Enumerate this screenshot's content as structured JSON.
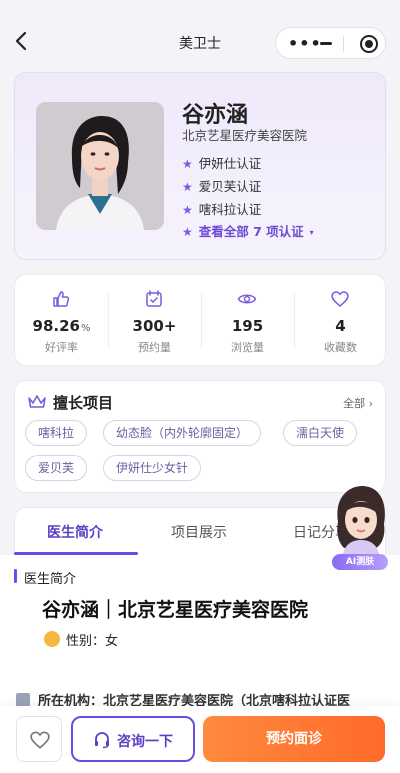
{
  "nav": {
    "title": "美卫士",
    "back_icon": "chevron-left-icon",
    "more_icon": "more-dots-icon",
    "minimize_icon": "minus-icon",
    "close_icon": "target-icon"
  },
  "doctor": {
    "name": "谷亦涵",
    "hospital": "北京艺星医疗美容医院",
    "certifications": [
      "伊妍仕认证",
      "爱贝芙认证",
      "嗐科拉认证"
    ],
    "view_all": "查看全部 7 项认证"
  },
  "stats": [
    {
      "value": "98.26",
      "unit": "%",
      "label": "好评率",
      "icon": "thumbs-up-icon"
    },
    {
      "value": "300+",
      "unit": "",
      "label": "预约量",
      "icon": "calendar-icon"
    },
    {
      "value": "195",
      "unit": "",
      "label": "浏览量",
      "icon": "eye-icon"
    },
    {
      "value": "4",
      "unit": "",
      "label": "收藏数",
      "icon": "heart-icon"
    }
  ],
  "specialties": {
    "title": "擅长项目",
    "all_label": "全部 ›",
    "tags": [
      "嗐科拉",
      "幼态脸（内外轮廓固定）",
      "濡白天使",
      "爱贝芙",
      "伊妍仕少女针"
    ]
  },
  "tabs": [
    {
      "label": "医生简介",
      "active": true
    },
    {
      "label": "项目展示",
      "active": false
    },
    {
      "label": "日记分享",
      "active": false
    }
  ],
  "profile": {
    "section_title": "医生简介",
    "headline": "谷亦涵｜北京艺星医疗美容医院",
    "gender": "性别：女",
    "institution": "所在机构：北京艺星医疗美容医院（北京嗐科拉认证医"
  },
  "ai": {
    "label": "AI测肤"
  },
  "actions": {
    "favorite_icon": "heart-outline-icon",
    "consult_label": "咨询一下",
    "book_label": "预约面诊"
  },
  "colors": {
    "accent": "#6b4ce0",
    "cta": "#ff7433"
  }
}
